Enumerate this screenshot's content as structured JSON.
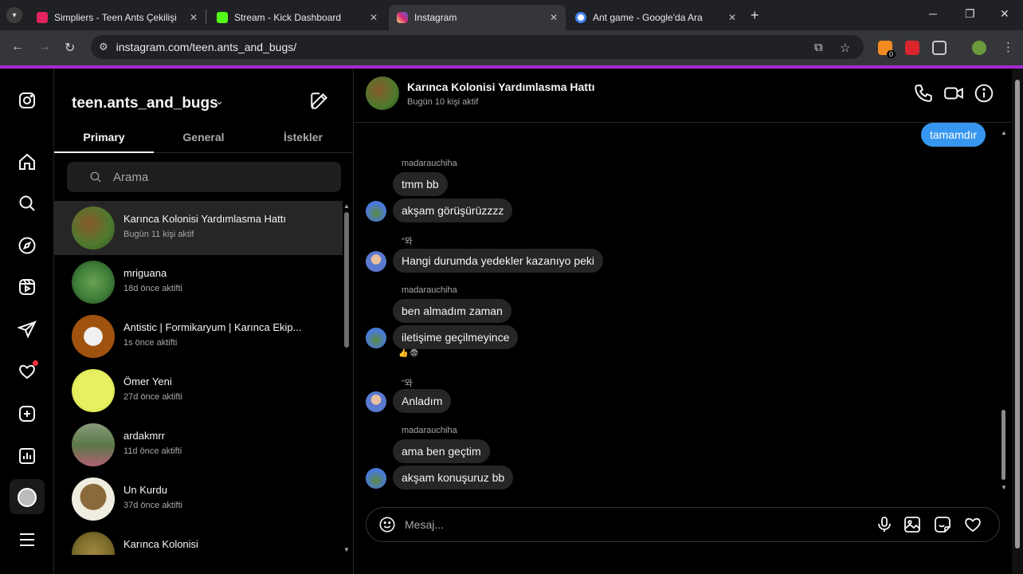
{
  "browser": {
    "tabs": [
      {
        "title": "Simpliers - Teen Ants Çekilişi",
        "favicon_color": "#e0245e"
      },
      {
        "title": "Stream - Kick Dashboard",
        "favicon_color": "#53fc18"
      },
      {
        "title": "Instagram",
        "favicon_color": "#d62976"
      },
      {
        "title": "Ant game - Google'da Ara",
        "favicon_color": "#4285f4"
      }
    ],
    "active_tab_index": 2,
    "url": "instagram.com/teen.ants_and_bugs/",
    "new_tab_symbol": "+",
    "extension_badge": "0"
  },
  "sidebar": {
    "items": [
      "instagram-logo",
      "home",
      "search",
      "explore",
      "reels",
      "messages",
      "notifications",
      "create",
      "dashboard",
      "profile",
      "more"
    ]
  },
  "inbox": {
    "username": "teen.ants_and_bugs",
    "tabs": [
      "Primary",
      "General",
      "İstekler"
    ],
    "active_tab": "Primary",
    "search_placeholder": "Arama",
    "conversations": [
      {
        "name": "Karınca Kolonisi Yardımlasma Hattı",
        "status": "Bugün 11 kişi aktif",
        "avatar": "#4d7a2e",
        "active": true
      },
      {
        "name": "mriguana",
        "status": "18d önce aktifti",
        "avatar": "#3f7f3a"
      },
      {
        "name": "Antistic | Formikaryum | Karınca Ekip...",
        "status": "1s önce aktifti",
        "avatar": "#a0520f"
      },
      {
        "name": "Ömer Yeni",
        "status": "27d önce aktifti",
        "avatar": "#e6f060"
      },
      {
        "name": "ardakmrr",
        "status": "11d önce aktifti",
        "avatar": "#6a7a5a"
      },
      {
        "name": "Un Kurdu",
        "status": "37d önce aktifti",
        "avatar": "#8a6a3a"
      },
      {
        "name": "Karınca Kolonisi",
        "status": "",
        "avatar": "#7a6a2a"
      }
    ]
  },
  "chat": {
    "title": "Karınca Kolonisi Yardımlasma Hattı",
    "status": "Bugün 10 kişi aktif",
    "my_message": "tamamdır",
    "messages": [
      {
        "sender": "madarauchiha",
        "lines": [
          "tmm bb",
          "akşam görüşürüzzzz"
        ]
      },
      {
        "sender": "\"뫄",
        "lines": [
          "Hangi durumda yedekler kazanıyo peki"
        ]
      },
      {
        "sender": "madarauchiha",
        "lines": [
          "ben almadım zaman",
          "iletişime geçilmeyince"
        ],
        "reactions": [
          "👍",
          "😨"
        ]
      },
      {
        "sender": "\"뫄",
        "lines": [
          "Anladım"
        ]
      },
      {
        "sender": "madarauchiha",
        "lines": [
          "ama ben geçtim",
          "akşam konuşuruz bb"
        ]
      }
    ],
    "composer_placeholder": "Mesaj..."
  }
}
